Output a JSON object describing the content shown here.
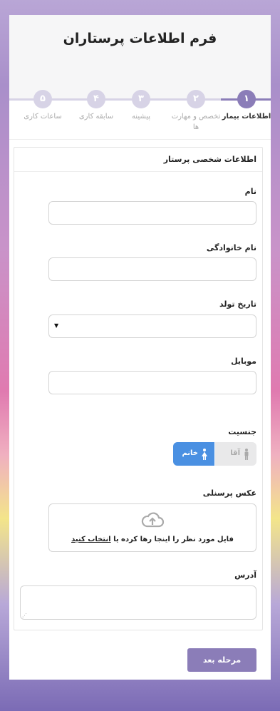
{
  "header": {
    "title": "فرم اطلاعات پرستاران"
  },
  "steps": [
    {
      "num": "۱",
      "label": "اطلاعات بیمار",
      "active": true
    },
    {
      "num": "۲",
      "label": "تخصص و مهارت ها",
      "active": false
    },
    {
      "num": "۳",
      "label": "پیشینه",
      "active": false
    },
    {
      "num": "۴",
      "label": "سابقه کاری",
      "active": false
    },
    {
      "num": "۵",
      "label": "ساعات کاری",
      "active": false
    }
  ],
  "section": {
    "title": "اطلاعات شخصی پرستار",
    "first_name": {
      "label": "نام",
      "value": ""
    },
    "last_name": {
      "label": "نام خانوادگی",
      "value": ""
    },
    "birth_date": {
      "label": "تاریخ تولد",
      "value": ""
    },
    "mobile": {
      "label": "موبایل",
      "value": ""
    },
    "gender": {
      "label": "جنسیت",
      "male": "آقا",
      "female": "خانم",
      "selected": "female"
    },
    "photo": {
      "label": "عکس پرسنلی",
      "text": "فایل مورد نظر را اینجا رها کرده یا",
      "link": "انتخاب کنید"
    },
    "address": {
      "label": "آدرس",
      "value": ""
    }
  },
  "footer": {
    "next_label": "مرحله بعد"
  },
  "colors": {
    "accent": "#8b7db8",
    "gender_selected": "#4a90e2",
    "step_inactive": "#d7d3e6"
  },
  "icons": {
    "male": "male-person-icon",
    "female": "female-person-icon",
    "upload": "cloud-upload-icon",
    "select": "caret-down-icon"
  }
}
